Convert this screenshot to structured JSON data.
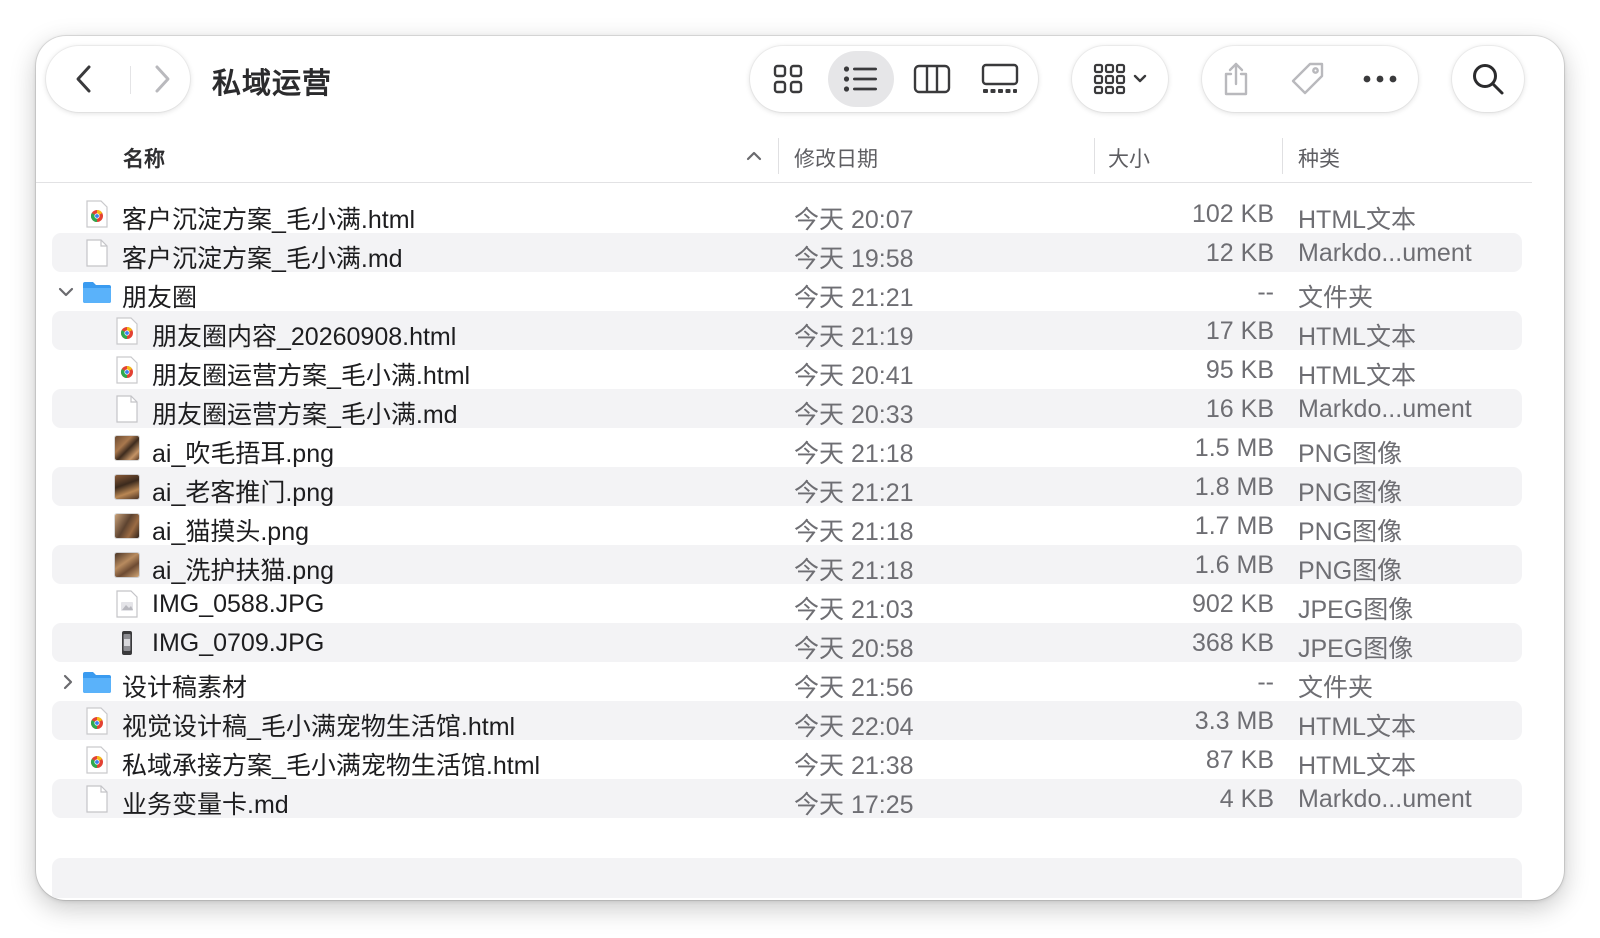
{
  "window": {
    "title": "私域运营"
  },
  "columns": {
    "name": "名称",
    "date": "修改日期",
    "size": "大小",
    "kind": "种类"
  },
  "files": [
    {
      "name": "客户沉淀方案_毛小满.html",
      "date": "今天 20:07",
      "size": "102 KB",
      "kind": "HTML文本",
      "icon": "html-file-icon",
      "level": 0
    },
    {
      "name": "客户沉淀方案_毛小满.md",
      "date": "今天 19:58",
      "size": "12 KB",
      "kind": "Markdo...ument",
      "icon": "document-icon",
      "level": 0
    },
    {
      "name": "朋友圈",
      "date": "今天 21:21",
      "size": "--",
      "kind": "文件夹",
      "icon": "folder-icon",
      "level": 0,
      "disclosure": "expanded"
    },
    {
      "name": "朋友圈内容_20260908.html",
      "date": "今天 21:19",
      "size": "17 KB",
      "kind": "HTML文本",
      "icon": "html-file-icon",
      "level": 1
    },
    {
      "name": "朋友圈运营方案_毛小满.html",
      "date": "今天 20:41",
      "size": "95 KB",
      "kind": "HTML文本",
      "icon": "html-file-icon",
      "level": 1
    },
    {
      "name": "朋友圈运营方案_毛小满.md",
      "date": "今天 20:33",
      "size": "16 KB",
      "kind": "Markdo...ument",
      "icon": "document-icon",
      "level": 1
    },
    {
      "name": "ai_吹毛捂耳.png",
      "date": "今天 21:18",
      "size": "1.5 MB",
      "kind": "PNG图像",
      "icon": "image-thumbnail-icon",
      "level": 1
    },
    {
      "name": "ai_老客推门.png",
      "date": "今天 21:21",
      "size": "1.8 MB",
      "kind": "PNG图像",
      "icon": "image-thumbnail-icon",
      "level": 1
    },
    {
      "name": "ai_猫摸头.png",
      "date": "今天 21:18",
      "size": "1.7 MB",
      "kind": "PNG图像",
      "icon": "image-thumbnail-icon",
      "level": 1
    },
    {
      "name": "ai_洗护扶猫.png",
      "date": "今天 21:18",
      "size": "1.6 MB",
      "kind": "PNG图像",
      "icon": "image-thumbnail-icon",
      "level": 1
    },
    {
      "name": "IMG_0588.JPG",
      "date": "今天 21:03",
      "size": "902 KB",
      "kind": "JPEG图像",
      "icon": "photo-file-icon",
      "level": 1
    },
    {
      "name": "IMG_0709.JPG",
      "date": "今天 20:58",
      "size": "368 KB",
      "kind": "JPEG图像",
      "icon": "photo-file-icon",
      "level": 1
    },
    {
      "name": "设计稿素材",
      "date": "今天 21:56",
      "size": "--",
      "kind": "文件夹",
      "icon": "folder-icon",
      "level": 0,
      "disclosure": "collapsed"
    },
    {
      "name": "视觉设计稿_毛小满宠物生活馆.html",
      "date": "今天 22:04",
      "size": "3.3 MB",
      "kind": "HTML文本",
      "icon": "html-file-icon",
      "level": 0
    },
    {
      "name": "私域承接方案_毛小满宠物生活馆.html",
      "date": "今天 21:38",
      "size": "87 KB",
      "kind": "HTML文本",
      "icon": "html-file-icon",
      "level": 0
    },
    {
      "name": "业务变量卡.md",
      "date": "今天 17:25",
      "size": "4 KB",
      "kind": "Markdo...ument",
      "icon": "document-icon",
      "level": 0
    }
  ],
  "colors": {
    "folder": "#3a9bf0",
    "row_alt": "#f3f3f5",
    "text": "#1d1d1f",
    "secondary_text": "#6e6e73"
  }
}
